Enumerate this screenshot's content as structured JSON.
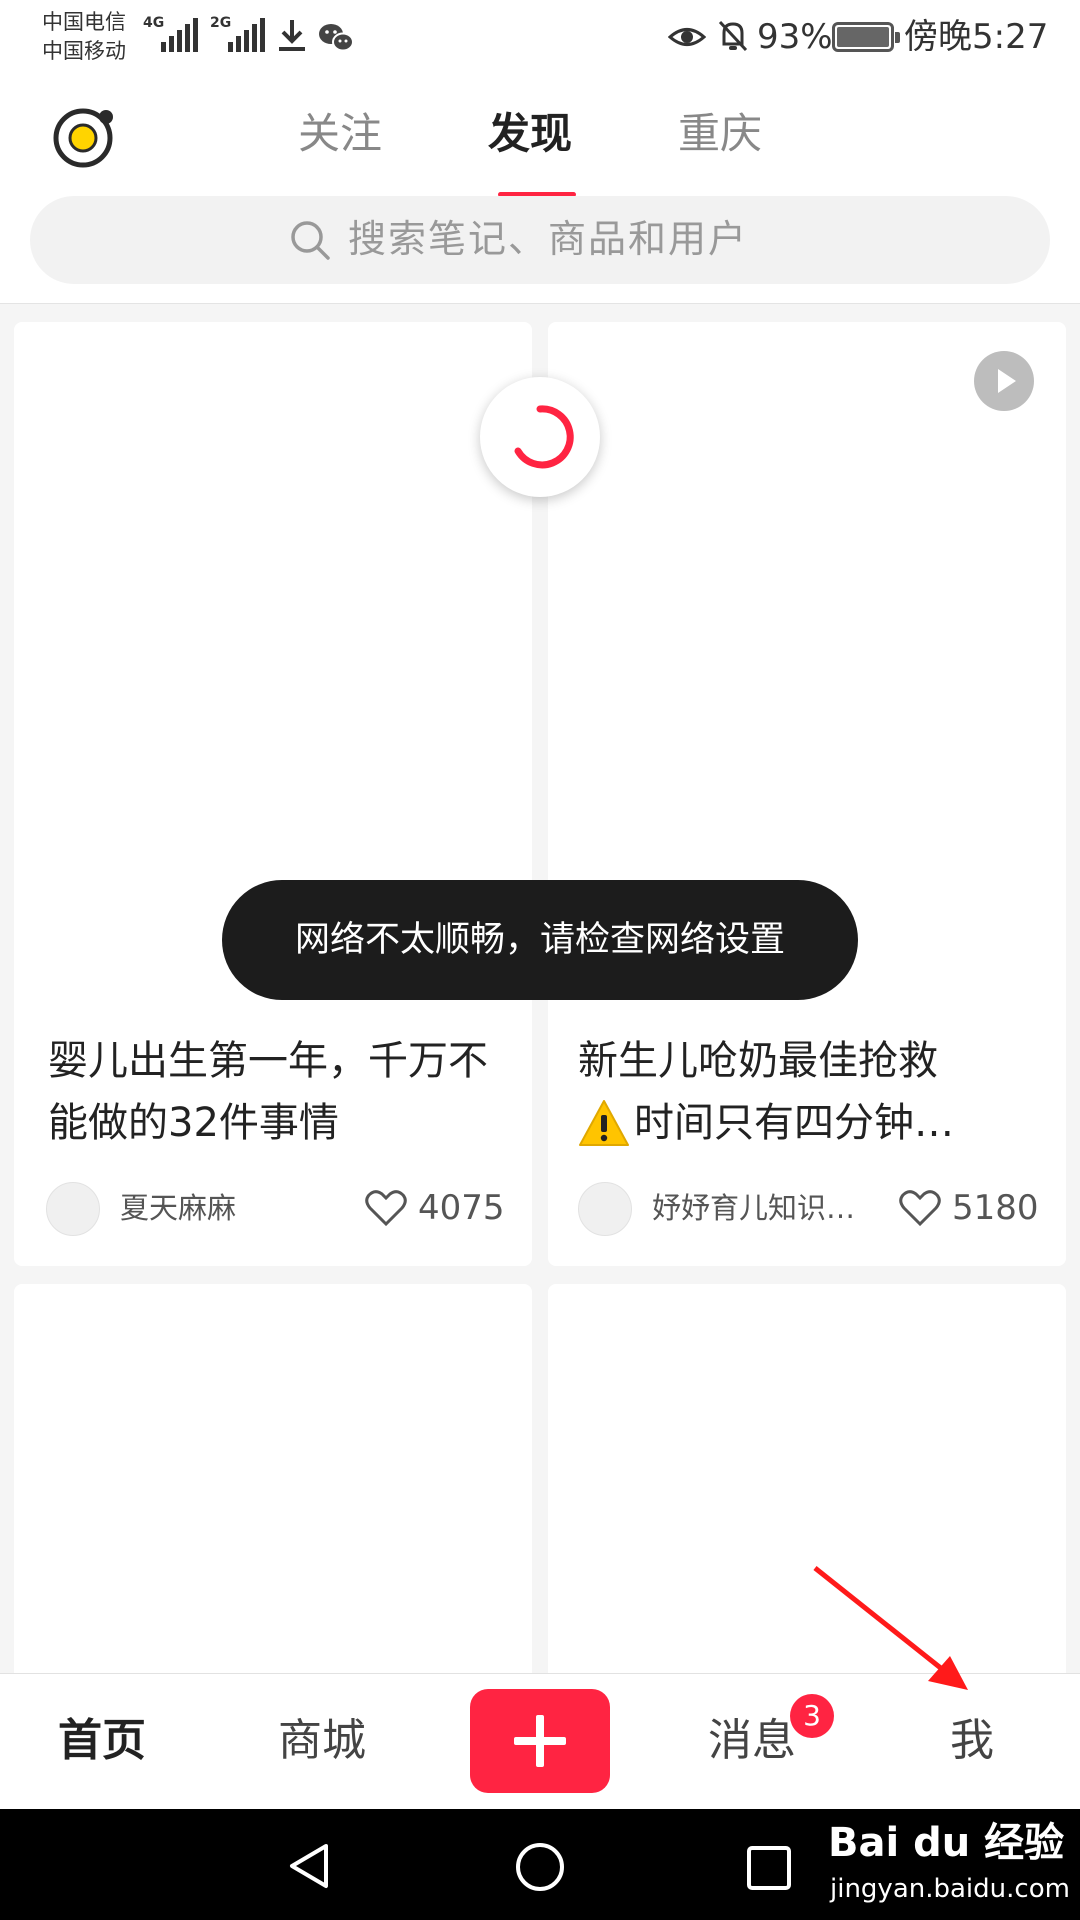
{
  "status_bar": {
    "carrier_1": "中国电信",
    "carrier_2": "中国移动",
    "network_1": "4G",
    "network_2": "2G",
    "battery": "93%",
    "time": "傍晚5:27"
  },
  "header": {
    "tabs": [
      {
        "label": "关注"
      },
      {
        "label": "发现",
        "active": true
      },
      {
        "label": "重庆"
      }
    ],
    "search": {
      "placeholder": "搜索笔记、商品和用户"
    }
  },
  "feed": {
    "cards": [
      {
        "title": "婴儿出生第一年，千万不能做的32件事情",
        "author": "夏天麻麻",
        "likes": "4075"
      },
      {
        "title": "新生儿呛奶最佳抢救⚠️时间只有四分钟…",
        "title_line_1": "新生儿呛奶最佳抢救",
        "title_line_2": "时间只有四分钟…",
        "author": "妤妤育儿知识…",
        "likes": "5180",
        "is_video": true
      }
    ]
  },
  "toast": {
    "message": "网络不太顺畅，请检查网络设置"
  },
  "bottom_nav": {
    "items": [
      {
        "label": "首页",
        "active": true
      },
      {
        "label": "商城"
      },
      {
        "label": "+"
      },
      {
        "label": "消息"
      },
      {
        "label": "我"
      }
    ],
    "messages_badge": "3"
  },
  "watermark": {
    "brand": "Bai du 经验",
    "url": "jingyan.baidu.com"
  },
  "colors": {
    "accent": "#ff2442",
    "toast_bg": "#1c1c1c",
    "logo_yellow": "#ffd400"
  },
  "icons": [
    "logo-icon",
    "search-icon",
    "play-icon",
    "heart-icon",
    "warning-icon",
    "back-icon",
    "home-icon",
    "recents-icon",
    "eye-icon",
    "bell-off-icon",
    "download-icon",
    "wechat-icon"
  ]
}
